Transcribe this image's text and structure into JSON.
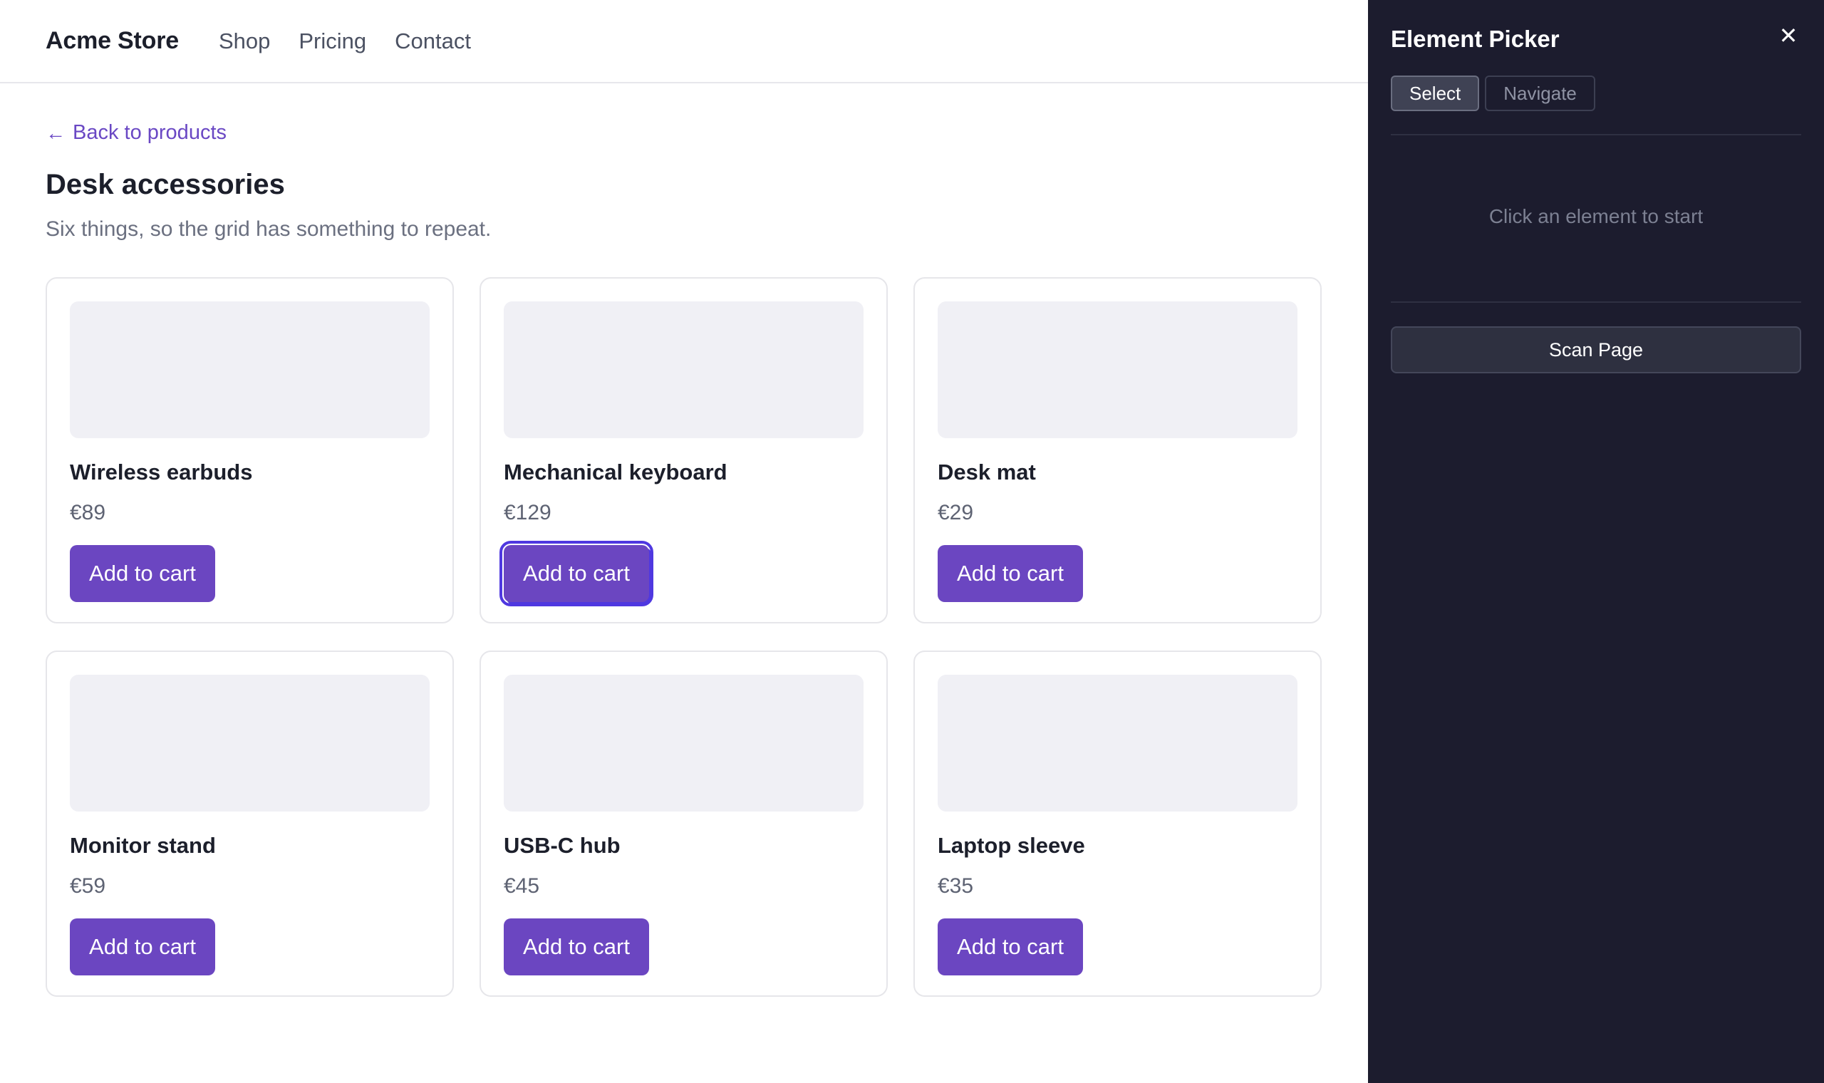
{
  "store": {
    "brand": "Acme Store",
    "nav": [
      "Shop",
      "Pricing",
      "Contact"
    ],
    "back_link": "Back to products",
    "page_title": "Desk accessories",
    "subtitle": "Six things, so the grid has something to repeat.",
    "add_to_cart_label": "Add to cart",
    "products": [
      {
        "name": "Wireless earbuds",
        "price": "€89"
      },
      {
        "name": "Mechanical keyboard",
        "price": "€129",
        "highlighted": true
      },
      {
        "name": "Desk mat",
        "price": "€29"
      },
      {
        "name": "Monitor stand",
        "price": "€59"
      },
      {
        "name": "USB-C hub",
        "price": "€45"
      },
      {
        "name": "Laptop sleeve",
        "price": "€35"
      }
    ]
  },
  "picker": {
    "title": "Element Picker",
    "close_icon": "close-icon",
    "modes": [
      "Select",
      "Navigate"
    ],
    "active_mode": "Select",
    "empty_message": "Click an element to start",
    "scan_label": "Scan Page"
  },
  "colors": {
    "accent": "#6b46c1",
    "highlight_outline": "#4f38e0",
    "panel_bg": "#1c1c2e"
  }
}
